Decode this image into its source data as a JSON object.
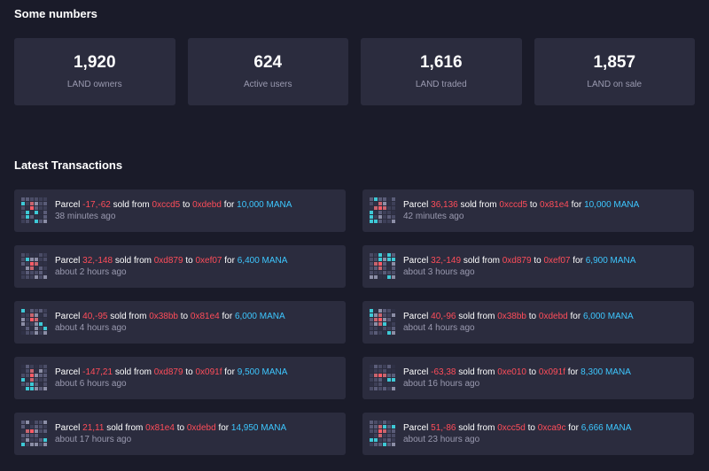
{
  "sections": {
    "numbers_title": "Some numbers",
    "transactions_title": "Latest Transactions"
  },
  "stats": [
    {
      "value": "1,920",
      "label": "LAND owners"
    },
    {
      "value": "624",
      "label": "Active users"
    },
    {
      "value": "1,616",
      "label": "LAND traded"
    },
    {
      "value": "1,857",
      "label": "LAND on sale"
    }
  ],
  "tx_words": {
    "parcel": "Parcel",
    "sold_from": "sold from",
    "to": "to",
    "for": "for"
  },
  "colors": {
    "background": "#1a1b29",
    "card": "#2b2c3e",
    "highlight": "#ff4d5a",
    "mana": "#3dc7ff",
    "muted": "#9a9ab0"
  },
  "transactions": [
    {
      "parcel": "-17,-62",
      "from": "0xccd5",
      "to": "0xdebd",
      "price": "10,000 MANA",
      "time": "38 minutes ago"
    },
    {
      "parcel": "36,136",
      "from": "0xccd5",
      "to": "0x81e4",
      "price": "10,000 MANA",
      "time": "42 minutes ago"
    },
    {
      "parcel": "32,-148",
      "from": "0xd879",
      "to": "0xef07",
      "price": "6,400 MANA",
      "time": "about 2 hours ago"
    },
    {
      "parcel": "32,-149",
      "from": "0xd879",
      "to": "0xef07",
      "price": "6,900 MANA",
      "time": "about 3 hours ago"
    },
    {
      "parcel": "40,-95",
      "from": "0x38bb",
      "to": "0x81e4",
      "price": "6,000 MANA",
      "time": "about 4 hours ago"
    },
    {
      "parcel": "40,-96",
      "from": "0x38bb",
      "to": "0xdebd",
      "price": "6,000 MANA",
      "time": "about 4 hours ago"
    },
    {
      "parcel": "-147,21",
      "from": "0xd879",
      "to": "0x091f",
      "price": "9,500 MANA",
      "time": "about 6 hours ago"
    },
    {
      "parcel": "-63,38",
      "from": "0xe010",
      "to": "0x091f",
      "price": "8,300 MANA",
      "time": "about 16 hours ago"
    },
    {
      "parcel": "21,11",
      "from": "0x81e4",
      "to": "0xdebd",
      "price": "14,950 MANA",
      "time": "about 17 hours ago"
    },
    {
      "parcel": "51,-86",
      "from": "0xcc5d",
      "to": "0xca9c",
      "price": "6,666 MANA",
      "time": "about 23 hours ago"
    }
  ]
}
